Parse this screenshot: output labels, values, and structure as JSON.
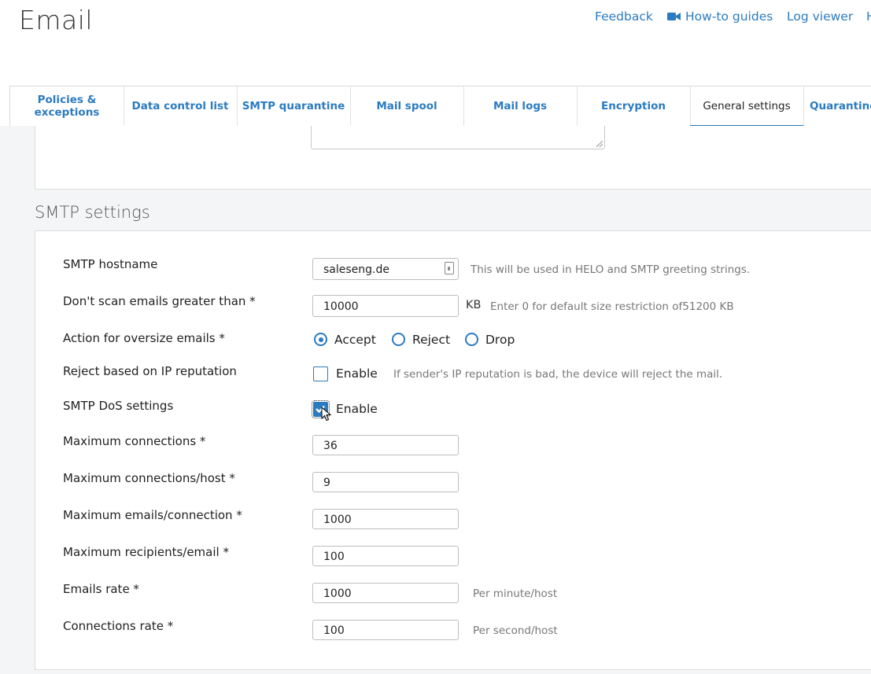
{
  "page": {
    "title": "Email"
  },
  "toplinks": {
    "feedback": "Feedback",
    "how_to": "How-to guides",
    "log_viewer": "Log viewer",
    "help": "H"
  },
  "tabs": [
    "Policies & exceptions",
    "Data control list",
    "SMTP quarantine",
    "Mail spool",
    "Mail logs",
    "Encryption",
    "General settings",
    "Quarantine s"
  ],
  "active_tab": "General settings",
  "smtp": {
    "section_title": "SMTP settings",
    "hostname": {
      "label": "SMTP hostname",
      "value": "saleseng.de",
      "hint": "This will be used in HELO and SMTP greeting strings."
    },
    "max_scan": {
      "label": "Don't scan emails greater than *",
      "value": "10000",
      "unit": "KB",
      "hint": "Enter 0 for default size restriction of51200 KB"
    },
    "oversize": {
      "label": "Action for oversize emails *",
      "options": [
        "Accept",
        "Reject",
        "Drop"
      ],
      "selected": "Accept"
    },
    "ip_reputation": {
      "label": "Reject based on IP reputation",
      "checkbox": "Enable",
      "checked": false,
      "hint": "If sender's IP reputation is bad, the device will reject the mail."
    },
    "dos": {
      "label": "SMTP DoS settings",
      "checkbox": "Enable",
      "checked": true
    },
    "max_connections": {
      "label": "Maximum connections *",
      "value": "36"
    },
    "max_conn_host": {
      "label": "Maximum connections/host *",
      "value": "9"
    },
    "max_emails_conn": {
      "label": "Maximum emails/connection *",
      "value": "1000"
    },
    "max_recipients": {
      "label": "Maximum recipients/email *",
      "value": "100"
    },
    "emails_rate": {
      "label": "Emails rate *",
      "value": "1000",
      "hint": "Per minute/host"
    },
    "conn_rate": {
      "label": "Connections rate *",
      "value": "100",
      "hint": "Per second/host"
    }
  },
  "colors": {
    "accent": "#2b7bc0",
    "background": "#f4f5f6"
  },
  "icons": [
    "video-camera-icon",
    "lock-icon",
    "resize-grip-icon",
    "mouse-cursor-icon"
  ]
}
